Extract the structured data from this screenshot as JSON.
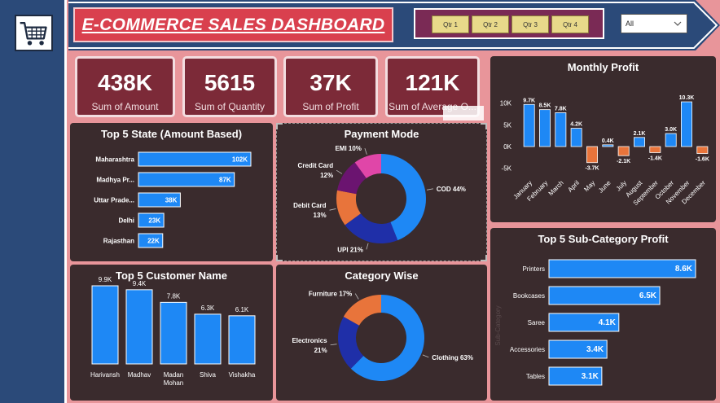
{
  "header": {
    "title": "E-COMMERCE SALES DASHBOARD",
    "quarters": [
      "Qtr 1",
      "Qtr 2",
      "Qtr 3",
      "Qtr 4"
    ],
    "dropdown_value": "All"
  },
  "kpis": [
    {
      "value": "438K",
      "label": "Sum of Amount"
    },
    {
      "value": "5615",
      "label": "Sum of Quantity"
    },
    {
      "value": "37K",
      "label": "Sum of Profit"
    },
    {
      "value": "121K",
      "label": "Sum of Average O..."
    }
  ],
  "colors": {
    "bar_blue": "#1e88f5",
    "negative_orange": "#e8743b",
    "panel_bg": "#3a2b2d",
    "kpi_bg": "#7c2a38",
    "title_red": "#d9404e",
    "navy": "#2b4a79"
  },
  "icons": {
    "cart": "shopping-cart-icon",
    "dropdown": "chevron-down-icon"
  },
  "chart_data": [
    {
      "type": "bar",
      "orientation": "horizontal",
      "title": "Top 5 State (Amount Based)",
      "categories": [
        "Maharashtra",
        "Madhya Pr...",
        "Uttar Prade...",
        "Delhi",
        "Rajasthan"
      ],
      "values": [
        102,
        87,
        38,
        23,
        22
      ],
      "labels": [
        "102K",
        "87K",
        "38K",
        "23K",
        "22K"
      ]
    },
    {
      "type": "pie",
      "donut": true,
      "title": "Payment Mode",
      "categories": [
        "COD",
        "UPI",
        "Debit Card",
        "Credit Card",
        "EMI"
      ],
      "values": [
        44,
        21,
        13,
        12,
        10
      ],
      "label_lines": [
        [
          "COD 44%"
        ],
        [
          "UPI 21%"
        ],
        [
          "Debit Card",
          "13%"
        ],
        [
          "Credit Card",
          "12%"
        ],
        [
          "EMI 10%"
        ]
      ],
      "colors": [
        "#1e88f5",
        "#1f2fa8",
        "#e8743b",
        "#6b1470",
        "#e046a8"
      ]
    },
    {
      "type": "bar",
      "title": "Monthly Profit",
      "categories": [
        "January",
        "February",
        "March",
        "April",
        "May",
        "June",
        "July",
        "August",
        "September",
        "October",
        "November",
        "December"
      ],
      "values": [
        9.7,
        8.5,
        7.8,
        4.2,
        -3.7,
        0.4,
        -2.1,
        2.1,
        -1.4,
        3.0,
        10.3,
        -1.6
      ],
      "labels": [
        "9.7K",
        "8.5K",
        "7.8K",
        "4.2K",
        "-3.7K",
        "0.4K",
        "-2.1K",
        "2.1K",
        "-1.4K",
        "3.0K",
        "10.3K",
        "-1.6K"
      ],
      "yticks": [
        10,
        5,
        0,
        -5
      ],
      "ytick_labels": [
        "10K",
        "5K",
        "0K",
        "-5K"
      ],
      "ylim": [
        -6,
        12
      ]
    },
    {
      "type": "bar",
      "title": "Top 5 Customer Name",
      "categories": [
        "Harivansh",
        "Madhav",
        "Madan Mohan",
        "Shiva",
        "Vishakha"
      ],
      "category_lines": [
        [
          "Harivansh"
        ],
        [
          "Madhav"
        ],
        [
          "Madan",
          "Mohan"
        ],
        [
          "Shiva"
        ],
        [
          "Vishakha"
        ]
      ],
      "values": [
        9.9,
        9.4,
        7.8,
        6.3,
        6.1
      ],
      "labels": [
        "9.9K",
        "9.4K",
        "7.8K",
        "6.3K",
        "6.1K"
      ]
    },
    {
      "type": "pie",
      "donut": true,
      "title": "Category Wise",
      "categories": [
        "Clothing",
        "Electronics",
        "Furniture"
      ],
      "values": [
        63,
        21,
        17
      ],
      "label_lines": [
        [
          "Clothing 63%"
        ],
        [
          "Electronics",
          "21%"
        ],
        [
          "Furniture 17%"
        ]
      ],
      "colors": [
        "#1e88f5",
        "#1f2fa8",
        "#e8743b"
      ]
    },
    {
      "type": "bar",
      "orientation": "horizontal",
      "title": "Top 5 Sub-Category Profit",
      "categories": [
        "Printers",
        "Bookcases",
        "Saree",
        "Accessories",
        "Tables"
      ],
      "values": [
        8.6,
        6.5,
        4.1,
        3.4,
        3.1
      ],
      "labels": [
        "8.6K",
        "6.5K",
        "4.1K",
        "3.4K",
        "3.1K"
      ],
      "ylabel": "Sub-Category"
    }
  ]
}
